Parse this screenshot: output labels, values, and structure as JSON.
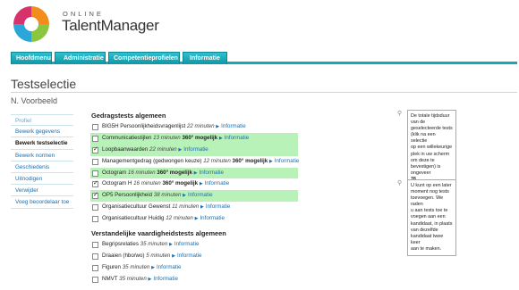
{
  "header": {
    "brand_online": "ONLINE",
    "brand_name": "TalentManager"
  },
  "nav": {
    "tabs": [
      {
        "label": "Hoofdmenu"
      },
      {
        "label": "Administratie"
      },
      {
        "label": "Competentieprofielen"
      },
      {
        "label": "Informatie"
      }
    ]
  },
  "page": {
    "title": "Testselectie",
    "person": "N. Voorbeeld"
  },
  "sidebar": {
    "items": [
      {
        "label": "Profiel"
      },
      {
        "label": "Bewerk gegevens"
      },
      {
        "label": "Bewerk testselectie"
      },
      {
        "label": "Bewerk normen"
      },
      {
        "label": "Geschiedenis"
      },
      {
        "label": "Uitnodigen"
      },
      {
        "label": "Verwijder"
      },
      {
        "label": "Voeg beoordelaar toe"
      }
    ]
  },
  "sections": [
    {
      "title": "Gedragstests algemeen",
      "rows": [
        {
          "name": "BIG5H Persoonlijkheidsvragenlijst",
          "time": "22 minuten",
          "tag": "",
          "checked": false,
          "highlight": false,
          "link": "Informatie"
        },
        {
          "name": "Communicatiestijlen",
          "time": "13 minuten",
          "tag": "360° mogelijk",
          "checked": false,
          "highlight": true,
          "link": "Informatie"
        },
        {
          "name": "Loopbaanwaarden",
          "time": "22 minuten",
          "tag": "",
          "checked": true,
          "highlight": true,
          "link": "Informatie"
        },
        {
          "name": "Managementgedrag (gedwongen keuze)",
          "time": "12 minuten",
          "tag": "360° mogelijk",
          "checked": false,
          "highlight": false,
          "link": "Informatie"
        },
        {
          "name": "Octogram",
          "time": "16 minuten",
          "tag": "360° mogelijk",
          "checked": false,
          "highlight": true,
          "link": "Informatie"
        },
        {
          "name": "Octogram H",
          "time": "16 minuten",
          "tag": "360° mogelijk",
          "checked": true,
          "highlight": false,
          "link": "Informatie"
        },
        {
          "name": "OP5 Persoonlijkheid",
          "time": "38 minuten",
          "tag": "",
          "checked": true,
          "highlight": true,
          "link": "Informatie"
        },
        {
          "name": "Organisatiecultuur Gewenst",
          "time": "11 minuten",
          "tag": "",
          "checked": false,
          "highlight": false,
          "link": "Informatie"
        },
        {
          "name": "Organisatiecultuur Huidig",
          "time": "12 minuten",
          "tag": "",
          "checked": false,
          "highlight": false,
          "link": "Informatie"
        }
      ]
    },
    {
      "title": "Verstandelijke vaardigheidstests algemeen",
      "rows": [
        {
          "name": "Begripsrelaties",
          "time": "35 minuten",
          "tag": "",
          "checked": false,
          "highlight": false,
          "link": "Informatie"
        },
        {
          "name": "Draaien (hbo/wo)",
          "time": "5 minuten",
          "tag": "",
          "checked": false,
          "highlight": false,
          "link": "Informatie"
        },
        {
          "name": "Figuren",
          "time": "35 minuten",
          "tag": "",
          "checked": false,
          "highlight": false,
          "link": "Informatie"
        },
        {
          "name": "NMVT",
          "time": "35 minuten",
          "tag": "",
          "checked": false,
          "highlight": false,
          "link": "Informatie"
        }
      ]
    }
  ],
  "info": {
    "box1_lines": [
      "De totale tijdsduur",
      "van de",
      "geselecteerde tests",
      "(klik na een selectie",
      "op een willekeurige",
      "plek in uw scherm",
      "om deze te",
      "bevestigen) is",
      "ongeveer",
      "76",
      "minuten."
    ],
    "box2_lines": [
      "U kunt op een later",
      "moment nog tests",
      "toevoegen. We raden",
      "u aan tests toe te",
      "voegen aan een",
      "kandidaat, in plaats",
      "van dezelfde",
      "kandidaat twee keer",
      "aan te maken."
    ]
  },
  "colors": {
    "accent": "#17a9b8",
    "highlight": "#b8f2b8",
    "link": "#1a6fb0"
  }
}
